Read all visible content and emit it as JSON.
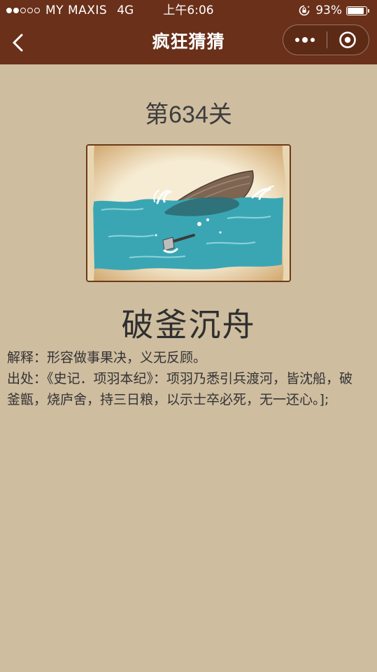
{
  "status": {
    "signal_filled": 2,
    "signal_empty": 3,
    "carrier": "MY MAXIS",
    "network": "4G",
    "time": "上午6:06",
    "battery_text": "93%",
    "battery_level": 0.93
  },
  "nav": {
    "title": "疯狂猜猜",
    "back_icon": "chevron-left-icon",
    "more_icon": "more-dots-icon",
    "close_icon": "target-close-icon"
  },
  "puzzle": {
    "level_title": "第634关",
    "image_subject": "sinking-boat-and-axe"
  },
  "answer": {
    "idiom": "破釜沉舟",
    "explanation": "解释：形容做事果决，义无反顾。",
    "source": "出处：《史记．项羽本纪》：项羽乃悉引兵渡河，皆沈船，破釜甑，烧庐舍，持三日粮，以示士卒必死，无一还心。];"
  },
  "colors": {
    "header_bg": "#6a301a",
    "page_bg": "#cfbda0",
    "water": "#3aa6b4",
    "frame_border": "#6b3a1b"
  }
}
